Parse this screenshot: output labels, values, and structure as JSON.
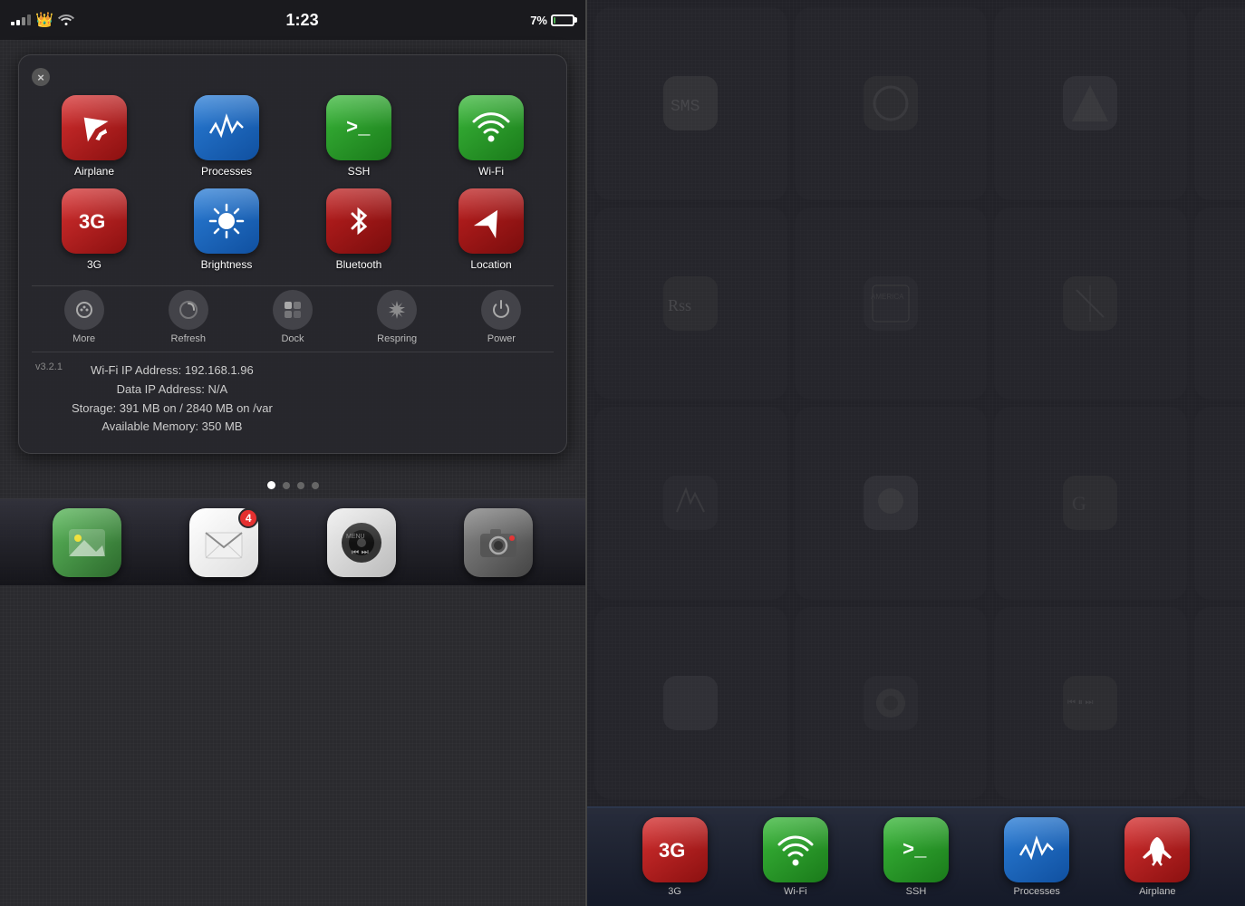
{
  "statusBar": {
    "time": "1:23",
    "batteryPercent": "7%",
    "signal": "signal"
  },
  "popup": {
    "closeLabel": "×",
    "version": "v3.2.1",
    "infoLines": [
      "Wi-Fi IP Address: 192.168.1.96",
      "Data IP Address: N/A",
      "Storage: 391 MB on / 2840 MB on /var",
      "Available Memory: 350 MB"
    ]
  },
  "topApps": [
    {
      "label": "Airplane",
      "bg": "red",
      "icon": "airplane"
    },
    {
      "label": "Processes",
      "bg": "blue",
      "icon": "wave"
    },
    {
      "label": "SSH",
      "bg": "green",
      "icon": "terminal"
    },
    {
      "label": "Wi-Fi",
      "bg": "green",
      "icon": "wifi"
    },
    {
      "label": "3G",
      "bg": "red",
      "icon": "3g"
    },
    {
      "label": "Brightness",
      "bg": "blue",
      "icon": "sun"
    },
    {
      "label": "Bluetooth",
      "bg": "red",
      "icon": "bluetooth"
    },
    {
      "label": "Location",
      "bg": "red",
      "icon": "location"
    }
  ],
  "quickActions": [
    {
      "label": "More",
      "icon": "gear"
    },
    {
      "label": "Refresh",
      "icon": "headphone"
    },
    {
      "label": "Dock",
      "icon": "apps"
    },
    {
      "label": "Respring",
      "icon": "sparkle"
    },
    {
      "label": "Power",
      "icon": "power"
    }
  ],
  "dockApps": [
    {
      "label": "Photos",
      "icon": "photos"
    },
    {
      "label": "Mail",
      "icon": "mail",
      "badge": "4"
    },
    {
      "label": "Music",
      "icon": "music"
    },
    {
      "label": "Camera",
      "icon": "camera"
    }
  ],
  "rightDockApps": [
    {
      "label": "3G",
      "bg": "red",
      "icon": "3g"
    },
    {
      "label": "Wi-Fi",
      "bg": "green",
      "icon": "wifi"
    },
    {
      "label": "SSH",
      "bg": "green",
      "icon": "terminal"
    },
    {
      "label": "Processes",
      "bg": "blue",
      "icon": "wave"
    },
    {
      "label": "Airplane",
      "bg": "red",
      "icon": "airplane"
    }
  ]
}
